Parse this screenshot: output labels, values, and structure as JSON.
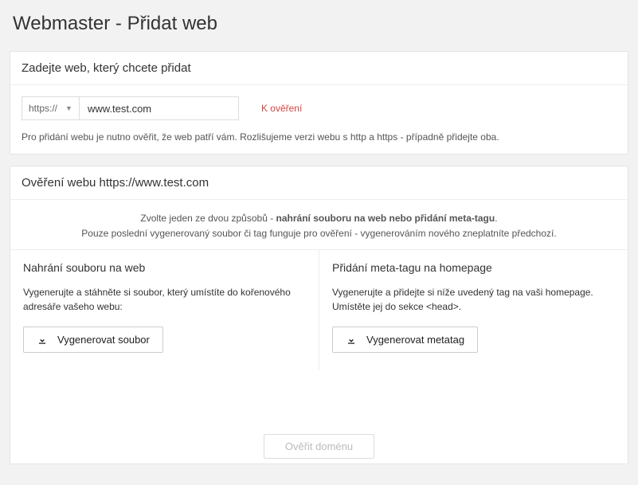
{
  "page": {
    "title": "Webmaster - Přidat web"
  },
  "addPanel": {
    "heading": "Zadejte web, který chcete přidat",
    "protocol": "https://",
    "urlValue": "www.test.com",
    "status": "K ověření",
    "note": "Pro přidání webu je nutno ověřit, že web patří vám. Rozlišujeme verzi webu s http a https - případně přidejte oba."
  },
  "verifyPanel": {
    "heading": "Ověření webu https://www.test.com",
    "introPrefix": "Zvolte jeden ze dvou způsobů - ",
    "introBold": "nahrání souboru na web nebo přidání meta-tagu",
    "introSuffix": ".",
    "introLine2": "Pouze poslední vygenerovaný soubor či tag funguje pro ověření - vygenerováním nového zneplatníte předchozí.",
    "left": {
      "title": "Nahrání souboru na web",
      "desc": "Vygenerujte a stáhněte si soubor, který umístíte do kořenového adresáře vašeho webu:",
      "button": "Vygenerovat soubor"
    },
    "right": {
      "title": "Přidání meta-tagu na homepage",
      "desc": "Vygenerujte a přidejte si níže uvedený tag na vaši homepage. Umístěte jej do sekce <head>.",
      "button": "Vygenerovat metatag"
    },
    "submit": "Ověřit doménu"
  }
}
